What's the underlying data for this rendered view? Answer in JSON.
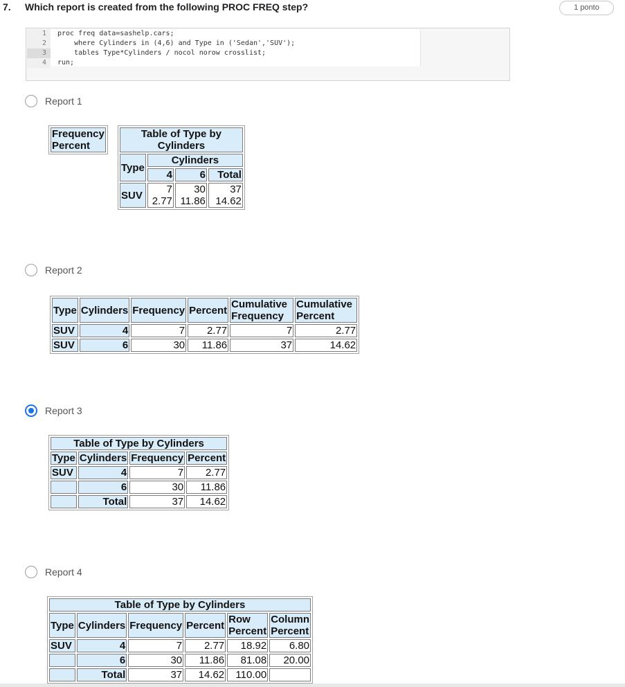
{
  "question": {
    "number": "7.",
    "text": "Which report is created from the following PROC FREQ step?",
    "points": "1 ponto"
  },
  "code": [
    {
      "n": "1",
      "text": "proc freq data=sashelp.cars;"
    },
    {
      "n": "2",
      "text": "    where Cylinders in (4,6) and Type in ('Sedan','SUV');"
    },
    {
      "n": "3",
      "text": "    tables Type*Cylinders / nocol norow crosslist;"
    },
    {
      "n": "4",
      "text": "run;"
    }
  ],
  "options": [
    {
      "label": "Report 1",
      "selected": false
    },
    {
      "label": "Report 2",
      "selected": false
    },
    {
      "label": "Report 3",
      "selected": true
    },
    {
      "label": "Report 4",
      "selected": false
    }
  ],
  "report1": {
    "legend_line1": "Frequency",
    "legend_line2": "Percent",
    "title_line1": "Table of Type by",
    "title_line2": "Cylinders",
    "row_header": "Type",
    "col_header": "Cylinders",
    "cols": [
      "4",
      "6",
      "Total"
    ],
    "row_label": "SUV",
    "freq": [
      "7",
      "30",
      "37"
    ],
    "pct": [
      "2.77",
      "11.86",
      "14.62"
    ]
  },
  "report2": {
    "headers": [
      "Type",
      "Cylinders",
      "Frequency",
      "Percent",
      "Cumulative",
      "Frequency",
      "Cumulative",
      "Percent"
    ],
    "rows": [
      [
        "SUV",
        "4",
        "7",
        "2.77",
        "7",
        "2.77"
      ],
      [
        "SUV",
        "6",
        "30",
        "11.86",
        "37",
        "14.62"
      ]
    ]
  },
  "report3": {
    "title": "Table of Type by Cylinders",
    "headers": [
      "Type",
      "Cylinders",
      "Frequency",
      "Percent"
    ],
    "rows": [
      [
        "SUV",
        "4",
        "7",
        "2.77"
      ],
      [
        "",
        "6",
        "30",
        "11.86"
      ],
      [
        "",
        "Total",
        "37",
        "14.62"
      ]
    ]
  },
  "report4": {
    "title": "Table of Type by Cylinders",
    "headers": [
      "Type",
      "Cylinders",
      "Frequency",
      "Percent",
      "Row",
      "Percent",
      "Column",
      "Percent"
    ],
    "rows": [
      [
        "SUV",
        "4",
        "7",
        "2.77",
        "18.92",
        "6.80"
      ],
      [
        "",
        "6",
        "30",
        "11.86",
        "81.08",
        "20.00"
      ],
      [
        "",
        "Total",
        "37",
        "14.62",
        "110.00",
        ""
      ]
    ]
  }
}
